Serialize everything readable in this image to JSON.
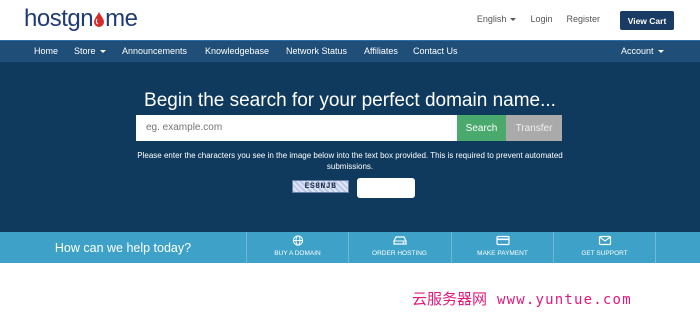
{
  "header": {
    "logo_text_host": "host",
    "logo_text_gnome_pre": "gn",
    "logo_text_gnome_post": "me",
    "language": "English",
    "login": "Login",
    "register": "Register",
    "view_cart": "View Cart"
  },
  "nav": {
    "items": [
      "Home",
      "Store",
      "Announcements",
      "Knowledgebase",
      "Network Status",
      "Affiliates",
      "Contact Us"
    ],
    "account": "Account"
  },
  "hero": {
    "title": "Begin the search for your perfect domain name...",
    "search_placeholder": "eg. example.com",
    "search_button": "Search",
    "transfer_button": "Transfer",
    "captcha_instructions": "Please enter the characters you see in the image below into the text box provided. This is required to prevent automated submissions.",
    "captcha_code": "ES8NJB"
  },
  "help": {
    "title": "How can we help today?",
    "items": [
      {
        "label": "BUY A DOMAIN",
        "icon": "globe-icon"
      },
      {
        "label": "ORDER HOSTING",
        "icon": "hdd-icon"
      },
      {
        "label": "MAKE PAYMENT",
        "icon": "credit-card-icon"
      },
      {
        "label": "GET SUPPORT",
        "icon": "envelope-icon"
      }
    ]
  },
  "watermark": {
    "cn": "云服务器网",
    "url": "www.yuntue.com"
  },
  "colors": {
    "navbar": "#1f4e79",
    "hero": "#0f3a5d",
    "search_button": "#4aa96c",
    "help_band": "#3ea2c8",
    "watermark": "#e0197c"
  }
}
